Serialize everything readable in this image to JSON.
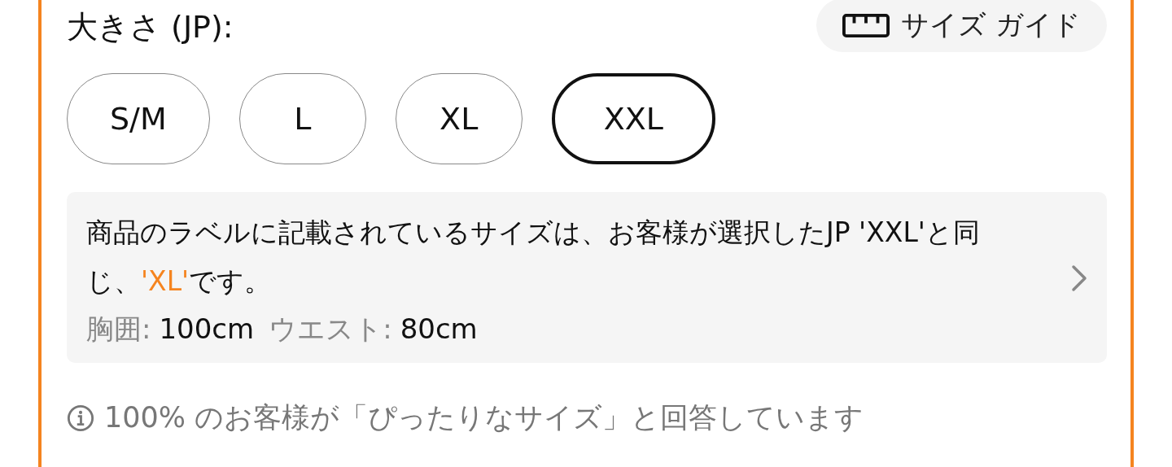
{
  "size_label": "大きさ (JP):",
  "size_guide": {
    "label": "サイズ ガイド"
  },
  "sizes": [
    {
      "label": "S/M",
      "selected": false
    },
    {
      "label": "L",
      "selected": false
    },
    {
      "label": "XL",
      "selected": false
    },
    {
      "label": "XXL",
      "selected": true
    }
  ],
  "size_note": {
    "message": [
      {
        "text": "商品のラベルに記載されているサイズは、お客様が選択したJP 'XXL'と同じ、",
        "highlight": false
      },
      {
        "text": "'XL'",
        "highlight": true
      },
      {
        "text": "です。",
        "highlight": false
      }
    ],
    "measurements": [
      {
        "label": "胸囲:",
        "value": "100cm"
      },
      {
        "label": "ウエスト:",
        "value": "80cm"
      }
    ]
  },
  "fit_info": "100% のお客様が「ぴったりなサイズ」と回答しています"
}
